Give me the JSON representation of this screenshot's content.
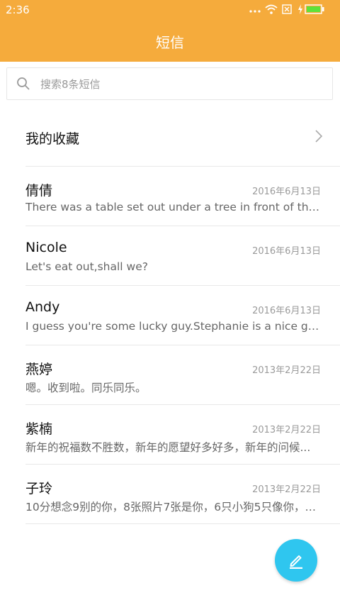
{
  "status": {
    "time": "2:36",
    "icons": [
      "more-dots-icon",
      "wifi-icon",
      "no-sim-icon",
      "charging-icon",
      "battery-icon"
    ]
  },
  "header": {
    "title": "短信",
    "color": "#f5ab3c"
  },
  "search": {
    "placeholder": "搜索8条短信"
  },
  "favorites": {
    "label": "我的收藏"
  },
  "messages": [
    {
      "name": "倩倩",
      "date": "2016年6月13日",
      "preview": "There was a table set out under a tree in front of the ho..."
    },
    {
      "name": "Nicole",
      "date": "2016年6月13日",
      "preview": "Let's eat out,shall we?"
    },
    {
      "name": "Andy",
      "date": "2016年6月13日",
      "preview": "I guess you're some lucky guy.Stephanie is a nice girl."
    },
    {
      "name": "燕婷",
      "date": "2013年2月22日",
      "preview": "嗯。收到啦。同乐同乐。"
    },
    {
      "name": "紫楠",
      "date": "2013年2月22日",
      "preview": "新年的祝福数不胜数，新年的愿望好多好多，新年的问候..."
    },
    {
      "name": "子玲",
      "date": "2013年2月22日",
      "preview": "10分想念9别的你，8张照片7张是你，6只小狗5只像你，4..."
    }
  ],
  "fab": {
    "icon": "compose-icon",
    "color": "#2fc6ef"
  }
}
